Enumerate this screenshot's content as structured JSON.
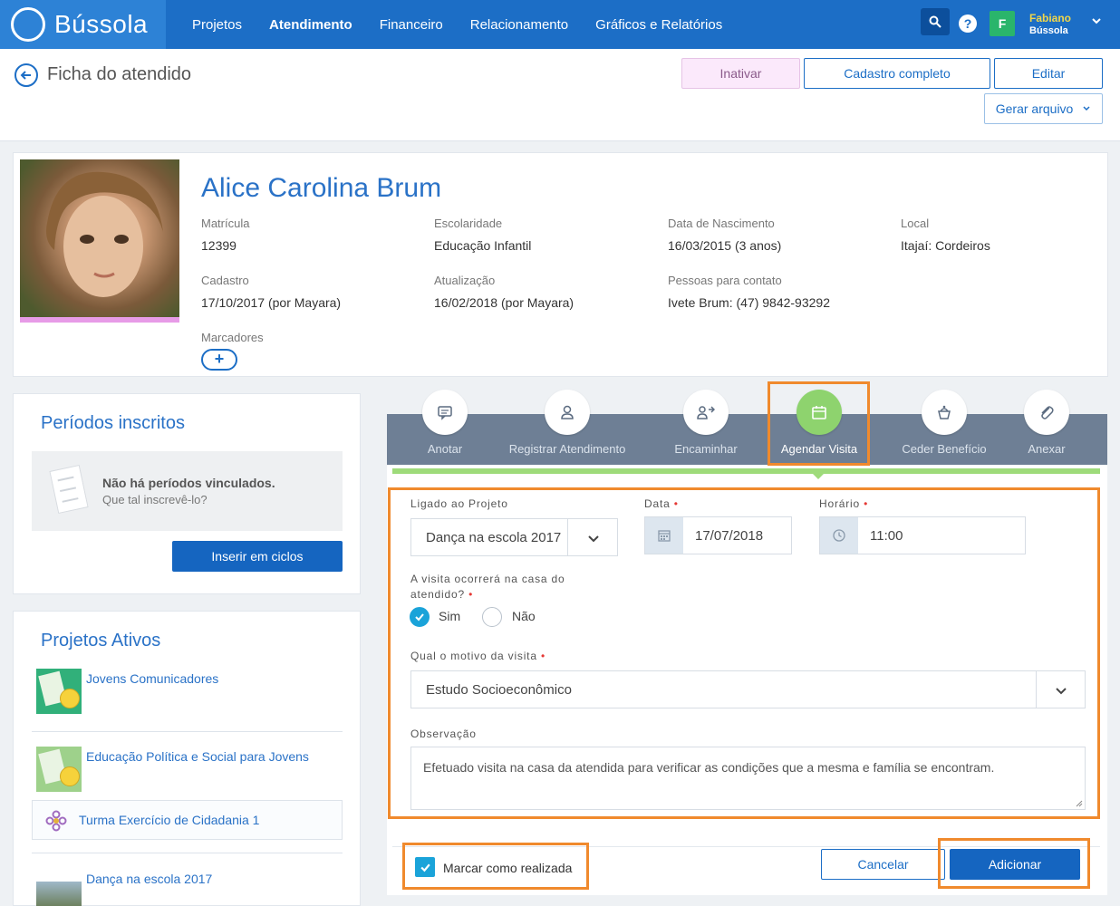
{
  "app": {
    "name": "Bússola"
  },
  "nav": {
    "items": [
      "Projetos",
      "Atendimento",
      "Financeiro",
      "Relacionamento",
      "Gráficos e Relatórios"
    ],
    "active": "Atendimento"
  },
  "user": {
    "initial": "F",
    "name": "Fabiano",
    "org": "Bússola"
  },
  "help": {
    "label": "?"
  },
  "header": {
    "title": "Ficha do atendido",
    "btn_inativar": "Inativar",
    "btn_cadastro": "Cadastro completo",
    "btn_editar": "Editar",
    "btn_gerar": "Gerar arquivo"
  },
  "profile": {
    "name": "Alice Carolina Brum",
    "fields": [
      {
        "label": "Matrícula",
        "value": "12399"
      },
      {
        "label": "Escolaridade",
        "value": "Educação Infantil"
      },
      {
        "label": "Data de Nascimento",
        "value": "16/03/2015 (3 anos)"
      },
      {
        "label": "Local",
        "value": "Itajaí: Cordeiros"
      },
      {
        "label": "Cadastro",
        "value": "17/10/2017 (por Mayara)"
      },
      {
        "label": "Atualização",
        "value": "16/02/2018 (por Mayara)"
      },
      {
        "label": "Pessoas para contato",
        "value": "Ivete Brum: (47) 9842-93292"
      }
    ],
    "markers_label": "Marcadores",
    "add_marker": "+"
  },
  "periodos": {
    "title": "Períodos inscritos",
    "empty_title": "Não há períodos vinculados.",
    "empty_sub": "Que tal inscrevê-lo?",
    "btn": "Inserir em ciclos"
  },
  "projetos": {
    "title": "Projetos Ativos",
    "items": [
      "Jovens Comunicadores",
      "Educação Política e Social para Jovens",
      "Turma Exercício de Cidadania 1",
      "Dança na escola 2017"
    ]
  },
  "tabs": [
    {
      "label": "Anotar",
      "icon": "chat-icon"
    },
    {
      "label": "Registrar Atendimento",
      "icon": "person-icon"
    },
    {
      "label": "Encaminhar",
      "icon": "forward-icon"
    },
    {
      "label": "Agendar Visita",
      "icon": "calendar-icon"
    },
    {
      "label": "Ceder Benefício",
      "icon": "gift-icon"
    },
    {
      "label": "Anexar",
      "icon": "paperclip-icon"
    }
  ],
  "active_tab": "Agendar Visita",
  "form": {
    "projeto_label": "Ligado ao Projeto",
    "projeto_value": "Dança na escola 2017",
    "data_label": "Data",
    "data_value": "17/07/2018",
    "horario_label": "Horário",
    "horario_value": "11:00",
    "casa_label_1": "A visita ocorrerá na casa do",
    "casa_label_2": "atendido?",
    "opt_sim": "Sim",
    "opt_nao": "Não",
    "selected_option": "Sim",
    "motivo_label": "Qual o motivo da visita",
    "motivo_value": "Estudo Socioeconômico",
    "obs_label": "Observação",
    "obs_value": "Efetuado visita na casa da atendida para verificar as condições que a mesma e família se encontram.",
    "realizada_label": "Marcar como realizada",
    "realizada_checked": true,
    "btn_cancel": "Cancelar",
    "btn_add": "Adicionar",
    "required_mark": "•"
  },
  "colors": {
    "primary": "#1c6ec6",
    "accent": "#1565c0",
    "active_tab": "#8ed36e",
    "highlight": "#f08a2d"
  }
}
